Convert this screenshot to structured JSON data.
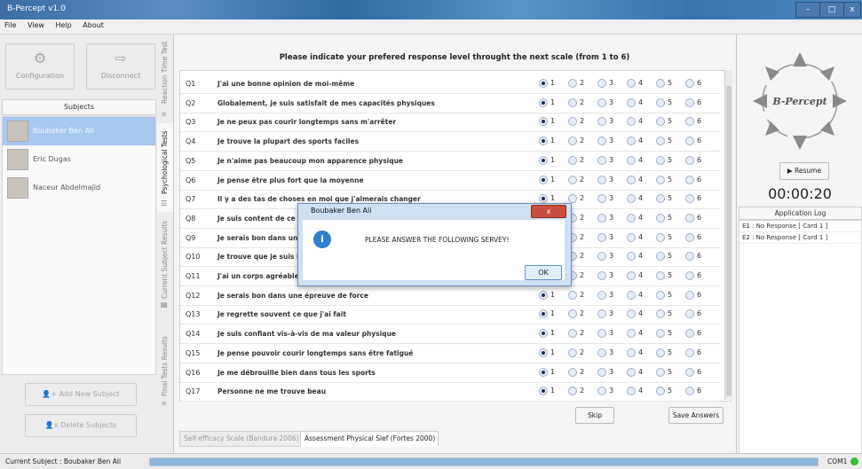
{
  "window": {
    "title": "B-Percept v1.0",
    "min": "–",
    "max": "□",
    "close": "x"
  },
  "menu": [
    "File",
    "View",
    "Help",
    "About"
  ],
  "left": {
    "configuration": "Configuration",
    "disconnect": "Disconnect",
    "subjects_header": "Subjects",
    "subjects": [
      "Boubaker Ben Ali",
      "Eric Dugas",
      "Naceur Abdelmajid"
    ],
    "add_subject": "Add New Subject",
    "delete_subjects": "Delete Subjects"
  },
  "vtabs": [
    "Reaction Time Test",
    "Psychological Tests",
    "Current Subject Results",
    "Final Tests Results"
  ],
  "main": {
    "heading": "Please indicate your prefered response level throught the next scale (from 1 to 6)",
    "options": [
      "1",
      "2",
      "3",
      "4",
      "5",
      "6"
    ],
    "questions": [
      {
        "id": "Q1",
        "text": "J'ai une bonne opinion de moi-même"
      },
      {
        "id": "Q2",
        "text": "Globalement, je suis satisfait de mes capacités physiques"
      },
      {
        "id": "Q3",
        "text": "Je ne peux pas courir longtemps sans m'arrêter"
      },
      {
        "id": "Q4",
        "text": "Je trouve la plupart des sports faciles"
      },
      {
        "id": "Q5",
        "text": "Je n'aime pas beaucoup mon apparence physique"
      },
      {
        "id": "Q6",
        "text": "Je pense être plus fort que la moyenne"
      },
      {
        "id": "Q7",
        "text": "Il y a des tas de choses en moi que j'aimerais changer"
      },
      {
        "id": "Q8",
        "text": "Je suis content de ce que"
      },
      {
        "id": "Q9",
        "text": "Je serais bon dans une"
      },
      {
        "id": "Q10",
        "text": "Je trouve que je suis bo"
      },
      {
        "id": "Q11",
        "text": "J'ai un corps agréable à"
      },
      {
        "id": "Q12",
        "text": "Je serais bon dans une épreuve de force"
      },
      {
        "id": "Q13",
        "text": "Je regrette souvent ce que j'ai fait"
      },
      {
        "id": "Q14",
        "text": "Je suis confiant vis-à-vis de ma valeur physique"
      },
      {
        "id": "Q15",
        "text": "Je pense pouvoir courir longtemps sans être fatigué"
      },
      {
        "id": "Q16",
        "text": "Je me débrouille bien dans tous les sports"
      },
      {
        "id": "Q17",
        "text": "Personne ne me trouve beau"
      }
    ],
    "skip": "Skip",
    "save": "Save Answers",
    "bottom_tabs": [
      "Self-efficacy Scale (Bandura 2006)",
      "Assessment Physical Slef (Fortes 2000)"
    ]
  },
  "right": {
    "logo": "B-Percept",
    "resume": "Resume",
    "timer": "00:00:20",
    "log_header": "Application Log",
    "log": [
      "E1 : No Response [ Card 1 ]",
      "E2 : No Response [ Card 1 ]"
    ]
  },
  "status": {
    "text": "Current Subject : Boubaker Ben Ali",
    "com": "COM1",
    "progress": 1.0
  },
  "dialog": {
    "title": "Boubaker Ben Ali",
    "close": "x",
    "message": "PLEASE ANSWER THE FOLLOWING SERVEY!",
    "ok": "OK"
  }
}
